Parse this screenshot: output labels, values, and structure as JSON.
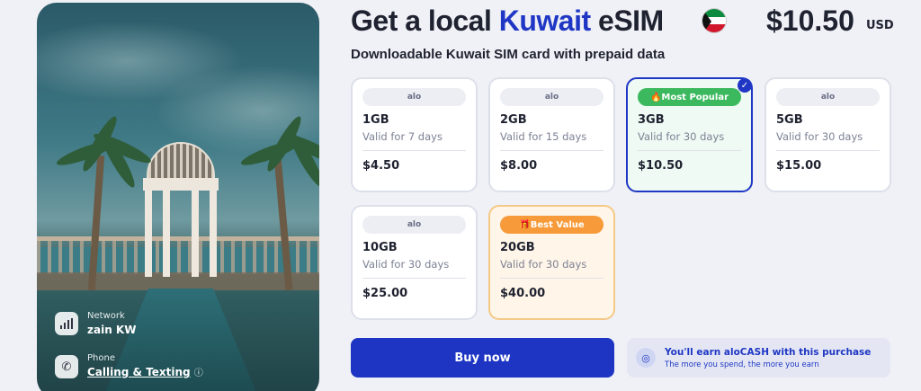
{
  "header": {
    "title_prefix": "Get a local ",
    "title_country": "Kuwait",
    "title_suffix": " eSIM",
    "price": "$10.50",
    "currency": "USD",
    "subtitle": "Downloadable Kuwait SIM card with prepaid data"
  },
  "hero": {
    "network_label": "Network",
    "network_value": "zain KW",
    "phone_label": "Phone",
    "phone_value": "Calling & Texting"
  },
  "plans": [
    {
      "brand": "alo",
      "size": "1GB",
      "validity": "Valid for 7 days",
      "price": "$4.50"
    },
    {
      "brand": "alo",
      "size": "2GB",
      "validity": "Valid for 15 days",
      "price": "$8.00"
    },
    {
      "badge": "Most Popular",
      "size": "3GB",
      "validity": "Valid for 30 days",
      "price": "$10.50",
      "selected": true
    },
    {
      "brand": "alo",
      "size": "5GB",
      "validity": "Valid for 30 days",
      "price": "$15.00"
    },
    {
      "brand": "alo",
      "size": "10GB",
      "validity": "Valid for 30 days",
      "price": "$25.00"
    },
    {
      "badge": "Best Value",
      "size": "20GB",
      "validity": "Valid for 30 days",
      "price": "$40.00"
    }
  ],
  "actions": {
    "buy_label": "Buy now",
    "earn_title": "You'll earn aloCASH with this purchase",
    "earn_sub": "The more you spend, the more you earn"
  },
  "colors": {
    "accent": "#1f37c4",
    "popular_badge": "#3cb95e",
    "best_badge": "#f79b3a"
  }
}
